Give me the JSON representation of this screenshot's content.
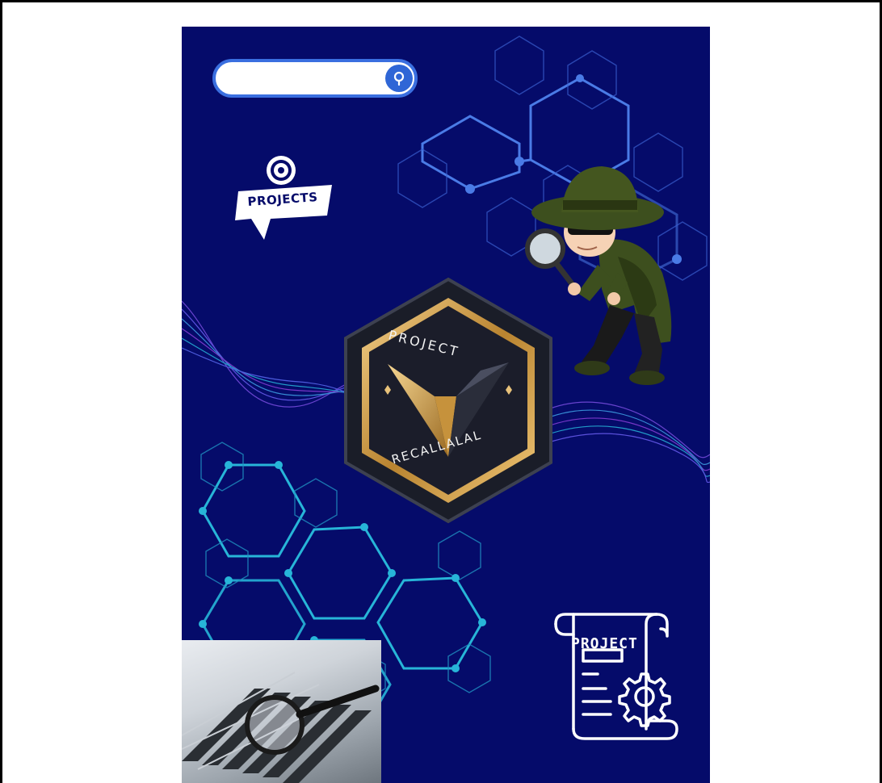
{
  "search": {
    "value": "",
    "placeholder": "",
    "button_icon": "search-icon"
  },
  "badge": {
    "label": "PROJECTS",
    "icon": "gear-icon"
  },
  "emblem": {
    "top_text": "PROJECT",
    "bottom_text": "RECALLALAL",
    "icon": "v-emblem-icon"
  },
  "document_icon": {
    "label": "PROJECT",
    "icon": "document-gear-icon"
  },
  "colors": {
    "background": "#050b6a",
    "accent_blue": "#3a6fe0",
    "cyan": "#27b5d8",
    "gold": "#c9973e"
  }
}
